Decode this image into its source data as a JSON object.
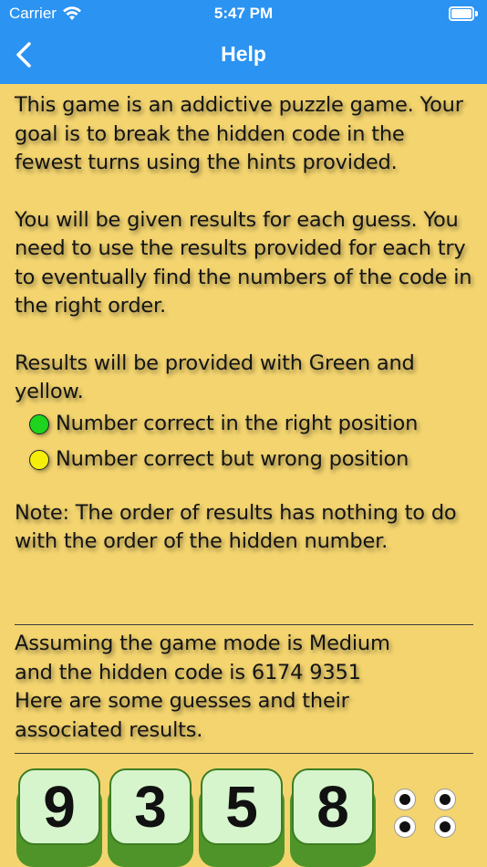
{
  "status_bar": {
    "carrier": "Carrier",
    "time": "5:47 PM",
    "wifi_icon": "wifi-icon",
    "battery_icon": "battery-icon"
  },
  "nav": {
    "title": "Help",
    "back_icon": "chevron-left-icon"
  },
  "help": {
    "intro": "This game is an addictive puzzle game. Your goal is to break the hidden code in the fewest turns using the hints provided.",
    "results_info": "You will be given results for each guess. You need to use the results provided for each try to eventually find the numbers of the code in the right order.",
    "colors_intro": "Results will be provided with Green and yellow.",
    "legend": [
      {
        "label": "Number correct in the right position",
        "color": "#1ed41e"
      },
      {
        "label": "Number correct but wrong position",
        "color": "#f5ee0a"
      }
    ],
    "note": "Note: The order of results has nothing to do with the order of the hidden number."
  },
  "example": {
    "text_lines": [
      "Assuming the game mode is Medium",
      "and the hidden code is 6174 9351",
      "Here are some guesses and their",
      "associated results."
    ]
  },
  "guess": {
    "digits": [
      "9",
      "3",
      "5",
      "8"
    ],
    "results": [
      "black",
      "black",
      "black",
      "black"
    ]
  },
  "colors": {
    "background": "#f3d46f",
    "nav": "#2b93f2",
    "tile_face": "#d7f5cc",
    "tile_base": "#4f9428"
  }
}
